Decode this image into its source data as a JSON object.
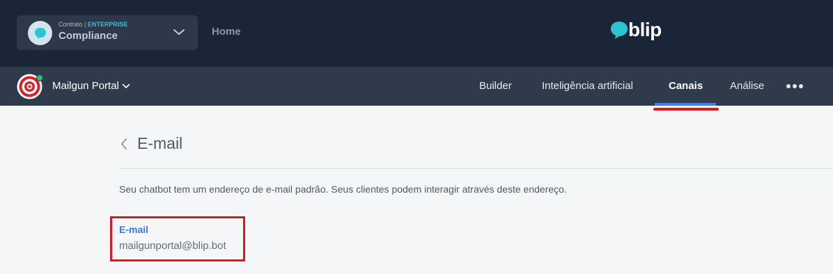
{
  "contract": {
    "prefix": "Contrato |",
    "tier": "ENTERPRISE",
    "name": "Compliance"
  },
  "topnav": {
    "home": "Home"
  },
  "brand": {
    "name": "blip",
    "color": "#2cc3d5"
  },
  "bot": {
    "name": "Mailgun Portal",
    "status_color": "#31bd82"
  },
  "tabs": [
    {
      "label": "Builder",
      "active": false
    },
    {
      "label": "Inteligência artificial",
      "active": false
    },
    {
      "label": "Canais",
      "active": true
    },
    {
      "label": "Análise",
      "active": false
    }
  ],
  "more_icon": "more-horizontal-icon",
  "page": {
    "title": "E-mail",
    "description": "Seu chatbot tem um endereço de e-mail padrão. Seus clientes podem interagir através deste endereço.",
    "email_label": "E-mail",
    "email_value": "mailgunportal@blip.bot"
  },
  "colors": {
    "header_bg": "#1b2538",
    "nav_bg": "#2f3a4a",
    "accent": "#3f7de8",
    "annotation": "#e0161e"
  }
}
